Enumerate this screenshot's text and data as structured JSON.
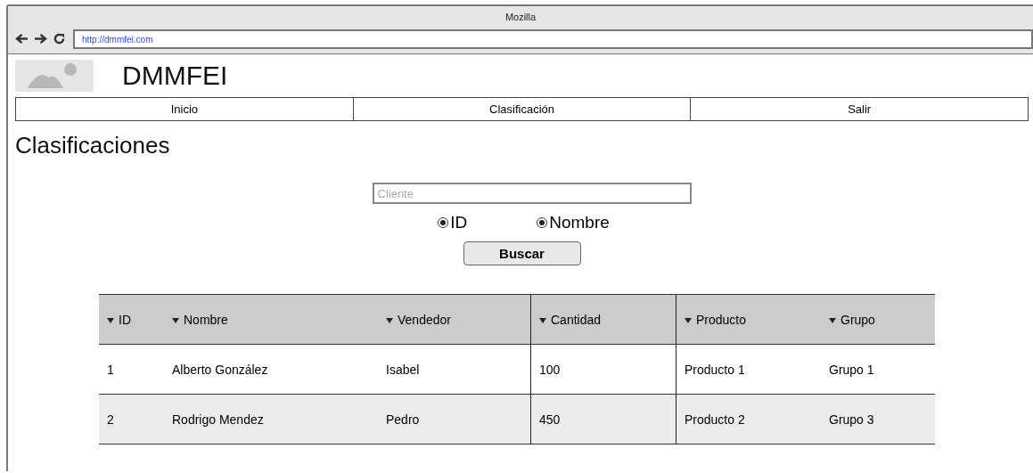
{
  "window": {
    "title": "Mozilla"
  },
  "address_bar": {
    "url": "http://dmmfei.com"
  },
  "site": {
    "title": "DMMFEI"
  },
  "nav": [
    {
      "label": "Inicio"
    },
    {
      "label": "Clasificación"
    },
    {
      "label": "Salir"
    }
  ],
  "heading": "Clasificaciones",
  "search": {
    "placeholder": "Cliente"
  },
  "radios": [
    {
      "label": "ID",
      "selected": true
    },
    {
      "label": "Nombre",
      "selected": true
    }
  ],
  "button": "Buscar",
  "table": {
    "columns": [
      "ID",
      "Nombre",
      "Vendedor",
      "Cantidad",
      "Producto",
      "Grupo"
    ],
    "rows": [
      [
        "1",
        "Alberto González",
        "Isabel",
        "100",
        "Producto 1",
        "Grupo 1"
      ],
      [
        "2",
        "Rodrigo Mendez",
        "Pedro",
        "450",
        "Producto 2",
        "Grupo 3"
      ]
    ]
  }
}
